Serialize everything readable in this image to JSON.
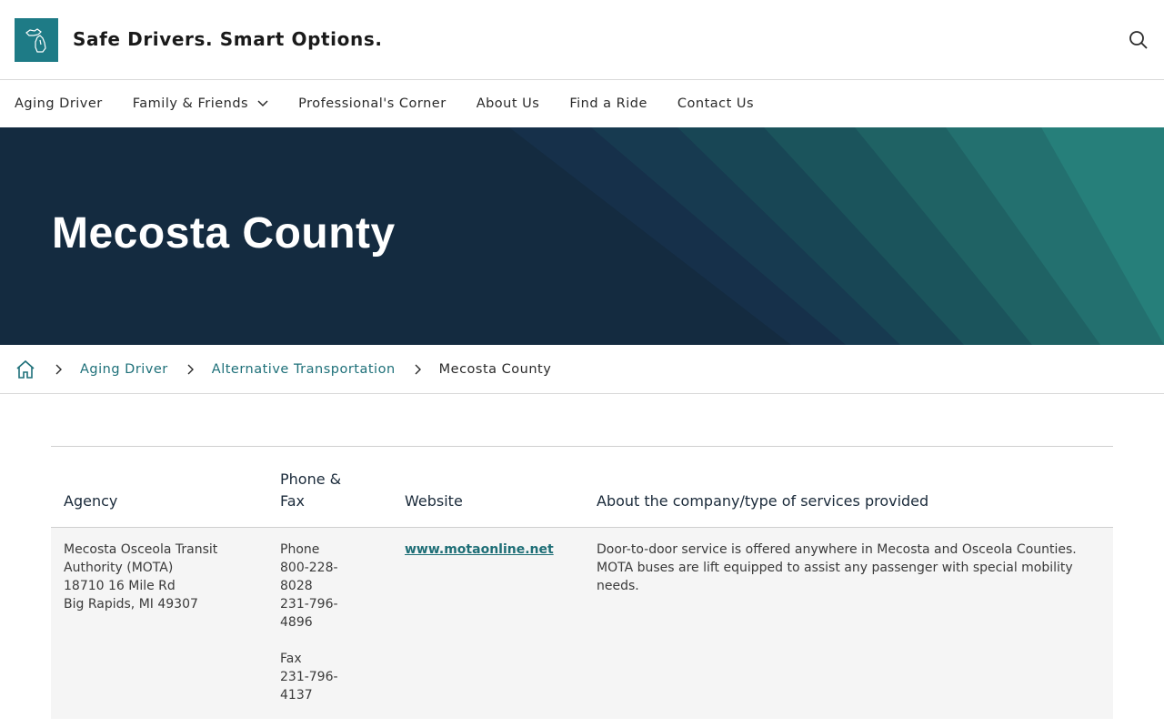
{
  "header": {
    "site_title": "Safe Drivers. Smart Options.",
    "logo_icon": "michigan-map-icon",
    "search_icon": "search-icon",
    "logo_color": "#1e7b86"
  },
  "nav": {
    "items": [
      {
        "label": "Aging Driver"
      },
      {
        "label": "Family & Friends",
        "has_dropdown": true
      },
      {
        "label": "Professional's Corner"
      },
      {
        "label": "About Us"
      },
      {
        "label": "Find a Ride"
      },
      {
        "label": "Contact Us"
      }
    ]
  },
  "hero": {
    "title": "Mecosta County",
    "bg_color": "#142b40",
    "accent_color": "#267f7a"
  },
  "breadcrumb": {
    "home_icon": "home-icon",
    "items": [
      {
        "label": "Aging Driver"
      },
      {
        "label": "Alternative Transportation"
      }
    ],
    "current": "Mecosta County"
  },
  "table": {
    "headers": [
      "Agency",
      "Phone & Fax",
      "Website",
      "About the company/type of services provided"
    ],
    "rows": [
      {
        "agency": {
          "name": "Mecosta Osceola Transit Authority (MOTA)",
          "address1": "18710 16 Mile Rd",
          "address2": "Big Rapids, MI 49307"
        },
        "phone": {
          "phone_label": "Phone",
          "phone1": "800-228-8028",
          "phone2": "231-796-4896",
          "fax_label": "Fax",
          "fax": "231-796-4137"
        },
        "website": "www.motaonline.net",
        "about": "Door-to-door service is offered anywhere in Mecosta and Osceola Counties. MOTA buses are lift equipped to assist any passenger with special mobility needs."
      }
    ]
  }
}
